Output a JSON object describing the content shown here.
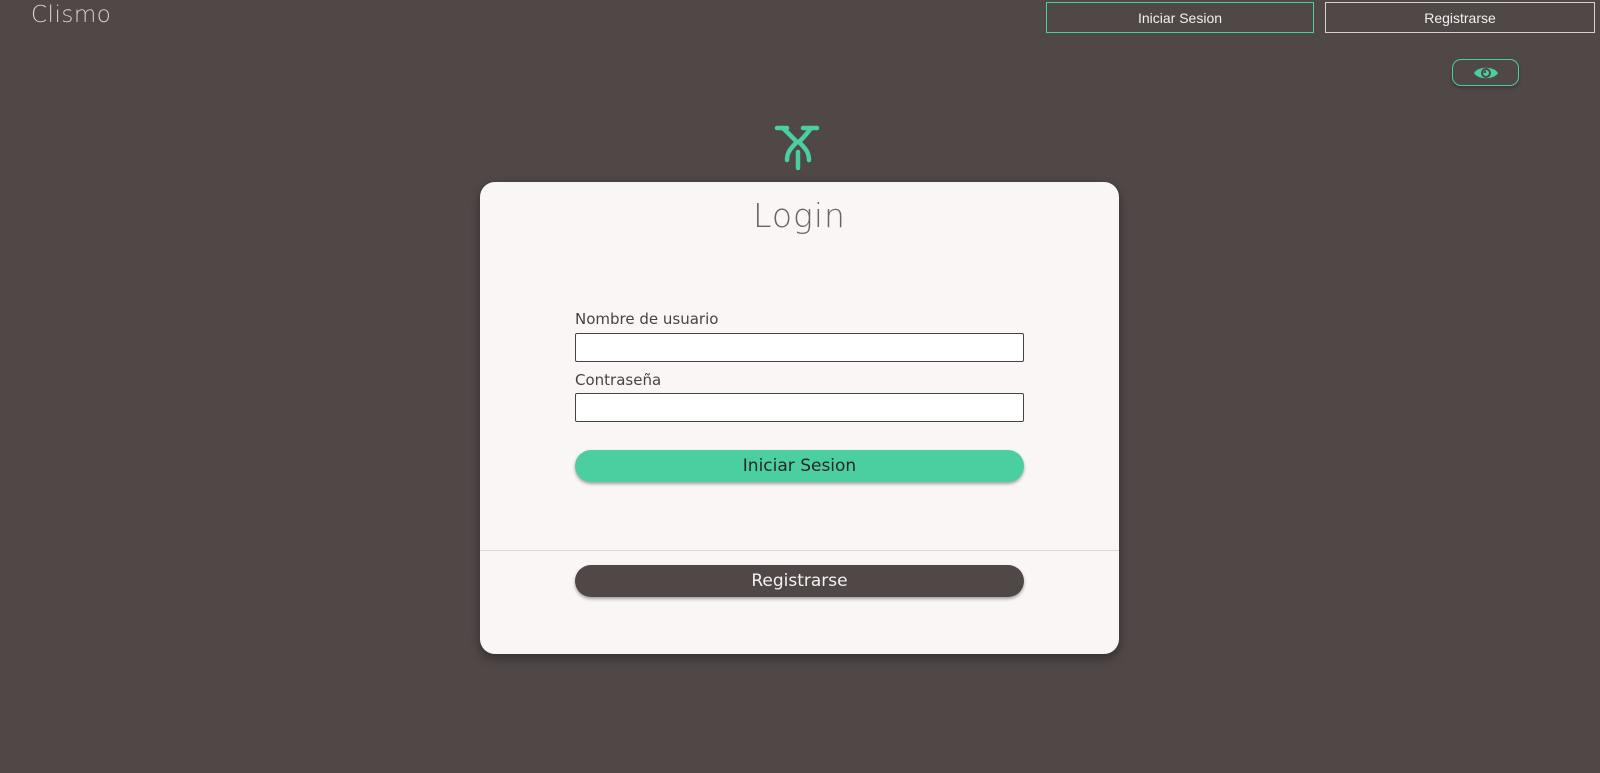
{
  "header": {
    "brand": "Clismo",
    "login_button": "Iniciar Sesion",
    "register_button": "Registrarse",
    "visibility_toggle_icon": "eye-icon"
  },
  "logo": {
    "icon": "bicycle-handlebar-icon",
    "color": "#4bcea0"
  },
  "login_card": {
    "title": "Login",
    "username_label": "Nombre de usuario",
    "username_value": "",
    "password_label": "Contraseña",
    "password_value": "",
    "submit_label": "Iniciar Sesion",
    "register_label": "Registrarse"
  },
  "colors": {
    "background": "#504747",
    "accent": "#4bcea0",
    "card": "#fbf6f6"
  }
}
